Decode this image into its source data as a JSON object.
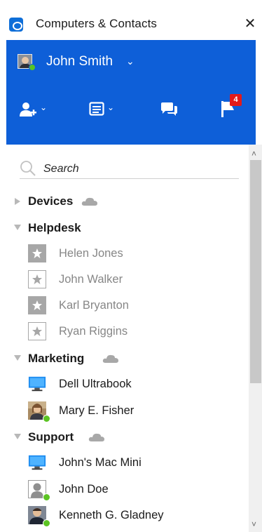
{
  "window": {
    "title": "Computers & Contacts",
    "close_glyph": "✕"
  },
  "colors": {
    "accent": "#0E5FD8",
    "online": "#5CC423",
    "badge": "#E21A1A",
    "offline_text": "#878787"
  },
  "header": {
    "user_name": "John Smith",
    "user_chevron": "⌄",
    "buttons": [
      {
        "icon": "add-contact-icon",
        "has_menu": true
      },
      {
        "icon": "list-view-icon",
        "has_menu": true
      },
      {
        "icon": "chat-icon",
        "has_menu": false
      },
      {
        "icon": "notifications-flag-icon",
        "badge": "4"
      }
    ]
  },
  "search": {
    "placeholder": "Search"
  },
  "groups": [
    {
      "name": "Devices",
      "expanded": false,
      "cloud": true,
      "items": []
    },
    {
      "name": "Helpdesk",
      "expanded": true,
      "cloud": false,
      "items": [
        {
          "name": "Helen Jones",
          "icon": "star-filled-icon",
          "online": false
        },
        {
          "name": "John Walker",
          "icon": "star-outline-icon",
          "online": false
        },
        {
          "name": "Karl Bryanton",
          "icon": "star-filled-icon",
          "online": false
        },
        {
          "name": "Ryan Riggins",
          "icon": "star-outline-icon",
          "online": false
        }
      ]
    },
    {
      "name": "Marketing",
      "expanded": true,
      "cloud": true,
      "items": [
        {
          "name": "Dell Ultrabook",
          "icon": "computer-monitor-icon",
          "online": true
        },
        {
          "name": "Mary E. Fisher",
          "icon": "contact-photo-icon",
          "online": true
        }
      ]
    },
    {
      "name": "Support",
      "expanded": true,
      "cloud": true,
      "items": [
        {
          "name": "John's Mac Mini",
          "icon": "computer-monitor-icon",
          "online": true
        },
        {
          "name": "John Doe",
          "icon": "contact-avatar-icon",
          "online": true
        },
        {
          "name": "Kenneth G. Gladney",
          "icon": "contact-photo-icon",
          "online": true
        }
      ]
    }
  ]
}
